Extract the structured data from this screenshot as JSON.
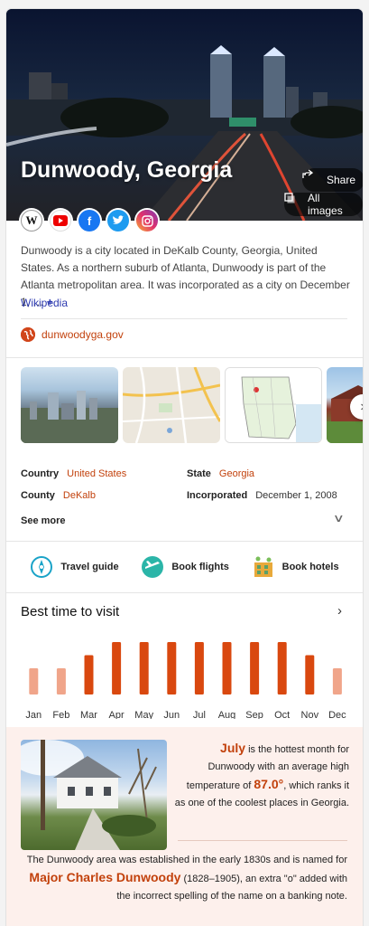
{
  "hero": {
    "title": "Dunwoody, Georgia",
    "share_label": "Share",
    "all_images_label": "All images"
  },
  "social": [
    "wikipedia-icon",
    "youtube-icon",
    "facebook-icon",
    "twitter-icon",
    "instagram-icon"
  ],
  "description": {
    "text": "Dunwoody is a city located in DeKalb County, Georgia, United States. As a northern suburb of Atlanta, Dunwoody is part of the Atlanta metropolitan area. It was incorporated as a city on December 1, …",
    "more": "+",
    "source": "Wikipedia"
  },
  "website": "dunwoodyga.gov",
  "facts": {
    "country_label": "Country",
    "country_value": "United States",
    "state_label": "State",
    "state_value": "Georgia",
    "county_label": "County",
    "county_value": "DeKalb",
    "incorporated_label": "Incorporated",
    "incorporated_value": "December 1, 2008",
    "see_more": "See more"
  },
  "actions": {
    "travel": "Travel guide",
    "flights": "Book flights",
    "hotels": "Book hotels"
  },
  "best_time": {
    "title": "Best time to visit"
  },
  "chart_data": {
    "type": "bar",
    "categories": [
      "Jan",
      "Feb",
      "Mar",
      "Apr",
      "May",
      "Jun",
      "Jul",
      "Aug",
      "Sep",
      "Oct",
      "Nov",
      "Dec"
    ],
    "values": [
      0.5,
      0.5,
      0.75,
      1.0,
      1.0,
      1.0,
      1.0,
      1.0,
      1.0,
      1.0,
      0.75,
      0.5
    ],
    "colors": {
      "light": "#f0a58a",
      "dark": "#d9480f"
    },
    "highlight": [
      "dark",
      "dark"
    ]
  },
  "july": {
    "pre": "",
    "month": "July",
    "line1": " is the hottest month for Dunwoody with an average high temperature of ",
    "temp": "87.0°",
    "line2": ", which ranks it as one of the coolest places in Georgia."
  },
  "history": {
    "pre": "The Dunwoody area was established in the early 1830s and is named for ",
    "name": "Major Charles Dunwoody",
    "post": " (1828–1905), an extra \"o\" added with the incorrect spelling of the name on a banking note."
  },
  "colors": {
    "accent": "#c2410c",
    "link": "#2d3ab0",
    "bar_dark": "#d9480f",
    "bar_light": "#f0a58a"
  }
}
